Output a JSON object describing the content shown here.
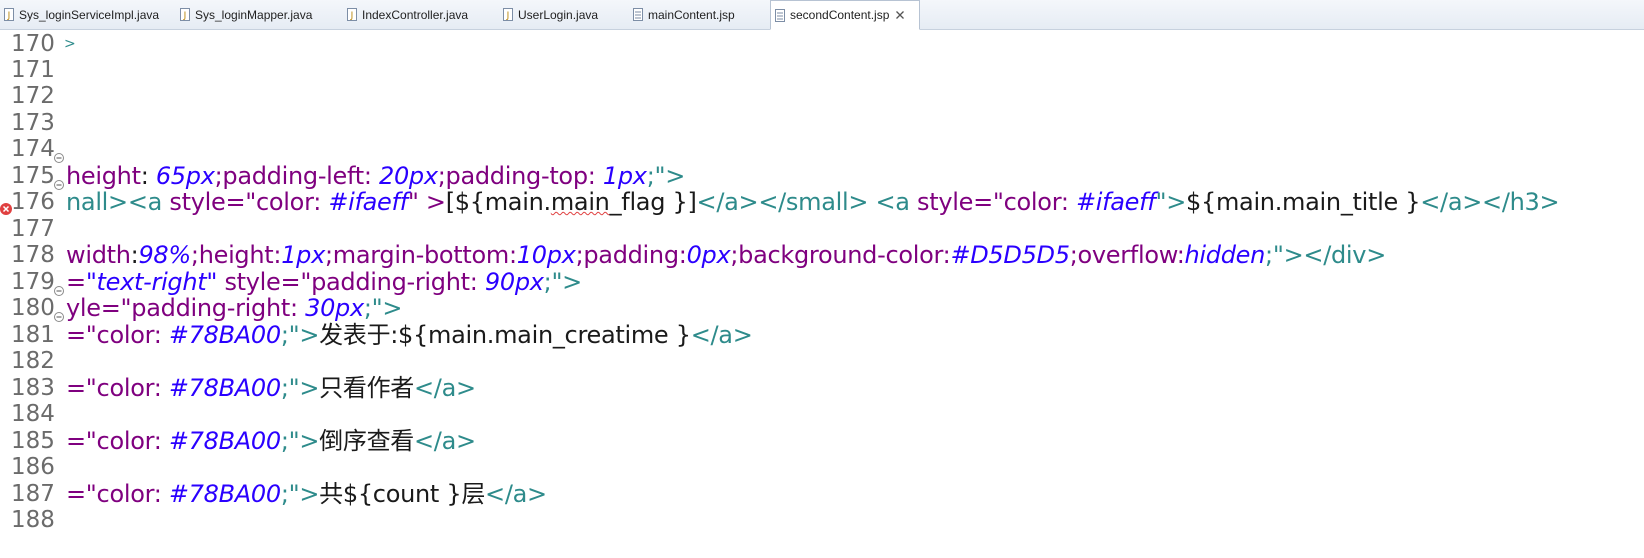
{
  "tabs": [
    {
      "label": "Sys_loginServiceImpl.java",
      "icon": "java-file-icon",
      "active": false
    },
    {
      "label": "Sys_loginMapper.java",
      "icon": "java-file-icon",
      "active": false
    },
    {
      "label": "IndexController.java",
      "icon": "java-file-icon",
      "active": false
    },
    {
      "label": "UserLogin.java",
      "icon": "java-file-icon",
      "active": false
    },
    {
      "label": "mainContent.jsp",
      "icon": "jsp-file-icon",
      "active": false
    },
    {
      "label": "secondContent.jsp",
      "icon": "jsp-file-icon",
      "active": true
    }
  ],
  "editor": {
    "lines": [
      {
        "num": "170"
      },
      {
        "num": "171"
      },
      {
        "num": "172"
      },
      {
        "num": "173"
      },
      {
        "num": "174"
      },
      {
        "num": "175"
      },
      {
        "num": "176"
      },
      {
        "num": "177"
      },
      {
        "num": "178"
      },
      {
        "num": "179"
      },
      {
        "num": "180"
      },
      {
        "num": "181"
      },
      {
        "num": "182"
      },
      {
        "num": "183"
      },
      {
        "num": "184"
      },
      {
        "num": "185"
      },
      {
        "num": "186"
      },
      {
        "num": "187"
      },
      {
        "num": "188"
      }
    ],
    "code": {
      "l170": ">",
      "l175_a": "height",
      "l175_b": ": ",
      "l175_c": "65px",
      "l175_d": ";padding-left: ",
      "l175_e": "20px",
      "l175_f": ";padding-top: ",
      "l175_g": "1px",
      "l175_h": ";\">",
      "l176_a": "nall>",
      "l176_b": "<a ",
      "l176_c": "style",
      "l176_d": "=\"color: ",
      "l176_e": "#ifaeff",
      "l176_f": "\" >",
      "l176_g": "[${main.",
      "l176_h": "main",
      "l176_i": "_flag }]",
      "l176_j": "</a></small> <a ",
      "l176_k": "style",
      "l176_l": "=\"color: ",
      "l176_m": "#ifaeff",
      "l176_n": "\">",
      "l176_o": "${main.main_title }",
      "l176_p": "</a></h3>",
      "l178_a": "width",
      "l178_b": ":",
      "l178_c": "98%",
      "l178_d": ";height:",
      "l178_e": "1px",
      "l178_f": ";margin-bottom:",
      "l178_g": "10px",
      "l178_h": ";padding:",
      "l178_i": "0px",
      "l178_j": ";background-color:",
      "l178_k": "#D5D5D5",
      "l178_l": ";overflow:",
      "l178_m": "hidden",
      "l178_n": ";\">",
      "l178_o": "</div>",
      "l179_a": "=",
      "l179_b": "\"text-right\"",
      "l179_c": " style",
      "l179_d": "=\"padding-right: ",
      "l179_e": "90px",
      "l179_f": ";\">",
      "l180_a": "yle",
      "l180_b": "=\"padding-right: ",
      "l180_c": "30px",
      "l180_d": ";\">",
      "l181_a": "=\"color: ",
      "l181_b": "#78BA00",
      "l181_c": ";\">",
      "l181_d": "发表于:${main.main_creatime }",
      "l181_e": "</a>",
      "l183_a": "=\"color: ",
      "l183_b": "#78BA00",
      "l183_c": ";\">",
      "l183_d": "只看作者",
      "l183_e": "</a>",
      "l185_a": "=\"color: ",
      "l185_b": "#78BA00",
      "l185_c": ";\">",
      "l185_d": "倒序查看",
      "l185_e": "</a>",
      "l187_a": "=\"color: ",
      "l187_b": "#78BA00",
      "l187_c": ";\">",
      "l187_d": "共${count }层",
      "l187_e": "</a>"
    }
  },
  "colors": {
    "tag": "#2e8b8b",
    "attr": "#7f007f",
    "value": "#2a00ff",
    "line_number": "#6b6b6b",
    "error": "#e04040"
  }
}
